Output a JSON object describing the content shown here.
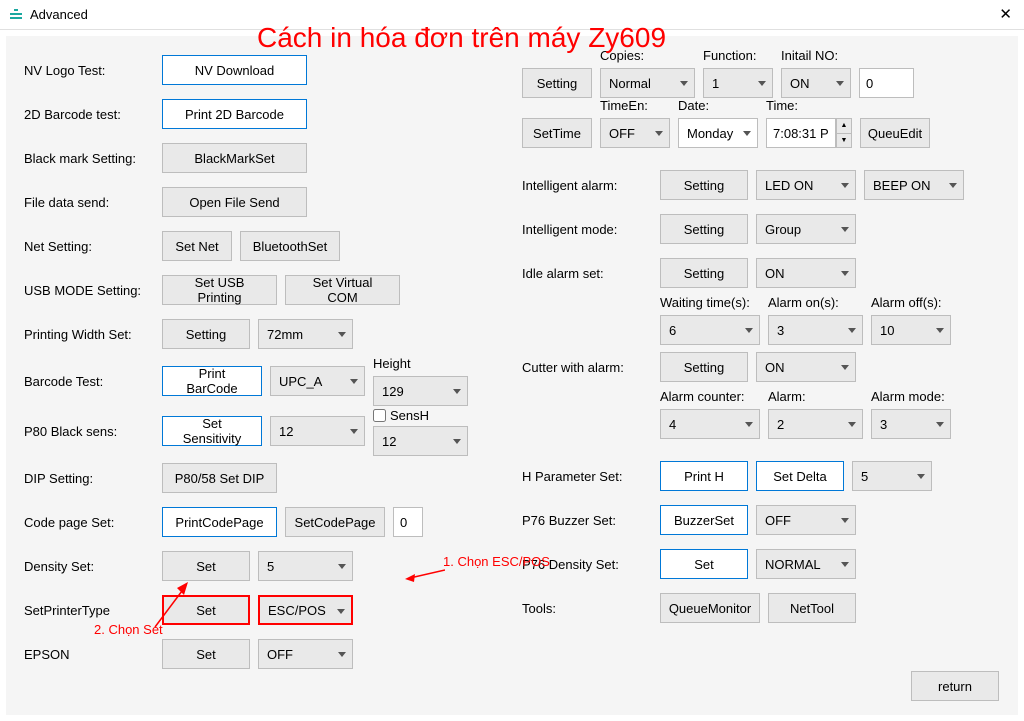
{
  "window": {
    "title": "Advanced",
    "close": "✕"
  },
  "overlay": {
    "title": "Cách in hóa đơn trên máy Zy609",
    "hint1": "1. Chọn ESC/POS",
    "hint2": "2. Chọn Set"
  },
  "left": {
    "nvLogo": {
      "lbl": "NV Logo Test:",
      "btn": "NV Download"
    },
    "barcode2d": {
      "lbl": "2D Barcode test:",
      "btn": "Print 2D Barcode"
    },
    "blackmark": {
      "lbl": "Black mark Setting:",
      "btn": "BlackMarkSet"
    },
    "filedata": {
      "lbl": "File data send:",
      "btn": "Open File Send"
    },
    "net": {
      "lbl": "Net Setting:",
      "btn1": "Set Net",
      "btn2": "BluetoothSet"
    },
    "usb": {
      "lbl": "USB MODE Setting:",
      "btn1": "Set USB Printing",
      "btn2": "Set Virtual COM"
    },
    "pwidth": {
      "lbl": "Printing Width Set:",
      "btn": "Setting",
      "sel": "72mm"
    },
    "bctest": {
      "lbl": "Barcode Test:",
      "btn": "Print BarCode",
      "sel": "UPC_A",
      "heightLbl": "Height",
      "height": "129"
    },
    "p80": {
      "lbl": "P80 Black sens:",
      "btn": "Set Sensitivity",
      "sel": "12",
      "sensh": "SensH",
      "senshSel": "12"
    },
    "dip": {
      "lbl": "DIP Setting:",
      "btn": "P80/58 Set DIP"
    },
    "codepage": {
      "lbl": "Code page Set:",
      "btn1": "PrintCodePage",
      "btn2": "SetCodePage",
      "val": "0"
    },
    "density": {
      "lbl": "Density Set:",
      "btn": "Set",
      "sel": "5"
    },
    "ptype": {
      "lbl": "SetPrinterType",
      "btn": "Set",
      "sel": "ESC/POS"
    },
    "epson": {
      "lbl": "EPSON",
      "btn": "Set",
      "sel": "OFF"
    }
  },
  "right": {
    "topRow": {
      "btn": "Setting",
      "copiesLbl": "Copies:",
      "copies": "Normal",
      "funcLbl": "Function:",
      "func": "1",
      "initLbl": "Initail NO:",
      "init": "ON",
      "noVal": "0"
    },
    "timeRow": {
      "btn": "SetTime",
      "timeEnLbl": "TimeEn:",
      "timeEn": "OFF",
      "dateLbl": "Date:",
      "date": "Monday",
      "timeLbl": "Time:",
      "time": "7:08:31 P",
      "queueBtn": "QueuEdit"
    },
    "ialarm": {
      "lbl": "Intelligent alarm:",
      "btn": "Setting",
      "sel1": "LED ON",
      "sel2": "BEEP ON"
    },
    "imode": {
      "lbl": "Intelligent mode:",
      "btn": "Setting",
      "sel": "Group"
    },
    "idle": {
      "lbl": "Idle alarm set:",
      "btn": "Setting",
      "sel": "ON"
    },
    "wait": {
      "waitLbl": "Waiting time(s):",
      "wait": "6",
      "onLbl": "Alarm on(s):",
      "on": "3",
      "offLbl": "Alarm off(s):",
      "off": "10"
    },
    "cutter": {
      "lbl": "Cutter with alarm:",
      "btn": "Setting",
      "sel": "ON"
    },
    "alarmC": {
      "cntLbl": "Alarm counter:",
      "cnt": "4",
      "almLbl": "Alarm:",
      "alm": "2",
      "modeLbl": "Alarm mode:",
      "mode": "3"
    },
    "hparam": {
      "lbl": "H Parameter Set:",
      "btn1": "Print H",
      "btn2": "Set Delta",
      "sel": "5"
    },
    "p76b": {
      "lbl": "P76 Buzzer Set:",
      "btn": "BuzzerSet",
      "sel": "OFF"
    },
    "p76d": {
      "lbl": "P76 Density Set:",
      "btn": "Set",
      "sel": "NORMAL"
    },
    "tools": {
      "lbl": "Tools:",
      "btn1": "QueueMonitor",
      "btn2": "NetTool"
    },
    "return": "return"
  }
}
